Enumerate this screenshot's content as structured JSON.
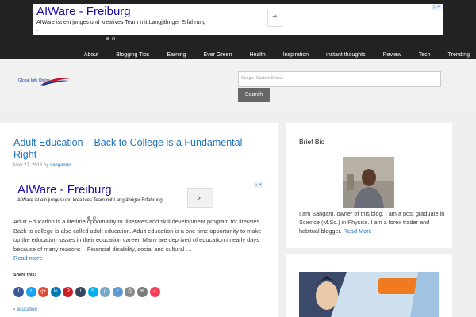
{
  "top_ad": {
    "title": "AIWare - Freiburg",
    "text": "AIWare ist ein junges und kreatives Team mit Langjähriger Erfahrung ."
  },
  "nav": {
    "items": [
      "About",
      "Blogging Tips",
      "Earning",
      "Ever Green",
      "Health",
      "Inspiration",
      "instant thoughts",
      "Review",
      "Tech",
      "Trending"
    ]
  },
  "header": {
    "logo_text": "Global Info Online",
    "search_placeholder": "Custom Search",
    "google_label": "Google",
    "search_button": "Search"
  },
  "article": {
    "title": "Adult Education – Back to College is a Fundamental Right",
    "date": "May 27, 2016",
    "by": "by",
    "author": "sangamkr",
    "ad_title": "AIWare - Freiburg",
    "ad_text": "AIWare ist ein junges und kreatives Team mit Langjähriger Erfahrung .",
    "body": "Adult Education is a lifetime opportunity to illiterates and skill development program for literates Back to college is also called adult education. Adult education is a one time opportunity to make up the education losses in their education career. Many are deprived of education in early days because of many reasons – Financial disability, social and cultural …",
    "read_more": "Read more",
    "share_label": "Share this:",
    "category": "education"
  },
  "share_icons": [
    {
      "name": "facebook-icon",
      "glyph": "f",
      "color": "#3b5998"
    },
    {
      "name": "twitter-icon",
      "glyph": "t",
      "color": "#1da1f2"
    },
    {
      "name": "google-plus-icon",
      "glyph": "g+",
      "color": "#dd4b39"
    },
    {
      "name": "linkedin-icon",
      "glyph": "in",
      "color": "#0077b5"
    },
    {
      "name": "pinterest-icon",
      "glyph": "P",
      "color": "#cb2027"
    },
    {
      "name": "tumblr-icon",
      "glyph": "t",
      "color": "#35465c"
    },
    {
      "name": "skype-icon",
      "glyph": "S",
      "color": "#00aff0"
    },
    {
      "name": "pocket-icon",
      "glyph": "p",
      "color": "#7aa7c7"
    },
    {
      "name": "reddit-icon",
      "glyph": "r",
      "color": "#5f99cf"
    },
    {
      "name": "print-icon",
      "glyph": "⎙",
      "color": "#8a8a8a"
    },
    {
      "name": "email-icon",
      "glyph": "✉",
      "color": "#7a7a7a"
    },
    {
      "name": "pocket-save-icon",
      "glyph": "✓",
      "color": "#ef4056"
    }
  ],
  "sidebar": {
    "bio_title": "Brief Bio",
    "bio_text": "I am Sangam, owner of this blog. I am a post graduate in Science (M.Sc.) in Physics. I am a forex trader and habitual blogger.",
    "bio_more": "Read More"
  }
}
